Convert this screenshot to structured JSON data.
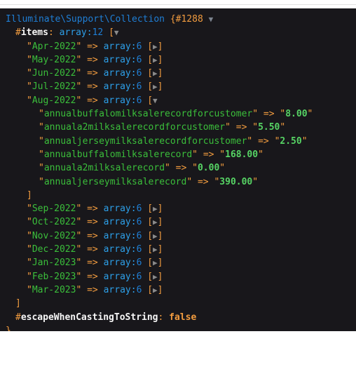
{
  "panel": {
    "background": "#18171B",
    "class_name": "Illuminate\\Support\\Collection",
    "object_id": "{#1288",
    "caret_open": "▼",
    "caret_closed": "▶",
    "open_bracket": "[",
    "close_bracket": "]",
    "close_brace": "}",
    "arrow": "=>",
    "quote": "\"",
    "colon": ":"
  },
  "items_prop": {
    "hash": "#",
    "name": "items",
    "colon": ":",
    "type": "array",
    "type_sep": ":",
    "count": "12"
  },
  "months": [
    {
      "key": "Apr-2022",
      "type": "array",
      "count": "6",
      "expanded": false
    },
    {
      "key": "May-2022",
      "type": "array",
      "count": "6",
      "expanded": false
    },
    {
      "key": "Jun-2022",
      "type": "array",
      "count": "6",
      "expanded": false
    },
    {
      "key": "Jul-2022",
      "type": "array",
      "count": "6",
      "expanded": false
    },
    {
      "key": "Aug-2022",
      "type": "array",
      "count": "6",
      "expanded": true
    },
    {
      "key": "Sep-2022",
      "type": "array",
      "count": "6",
      "expanded": false
    },
    {
      "key": "Oct-2022",
      "type": "array",
      "count": "6",
      "expanded": false
    },
    {
      "key": "Nov-2022",
      "type": "array",
      "count": "6",
      "expanded": false
    },
    {
      "key": "Dec-2022",
      "type": "array",
      "count": "6",
      "expanded": false
    },
    {
      "key": "Jan-2023",
      "type": "array",
      "count": "6",
      "expanded": false
    },
    {
      "key": "Feb-2023",
      "type": "array",
      "count": "6",
      "expanded": false
    },
    {
      "key": "Mar-2023",
      "type": "array",
      "count": "6",
      "expanded": false
    }
  ],
  "expanded_entries": [
    {
      "key": "annualbuffalomilksalerecordforcustomer",
      "value": "8.00"
    },
    {
      "key": "annuala2milksalerecordforcustomer",
      "value": "5.50"
    },
    {
      "key": "annualjerseymilksalerecordforcustomer",
      "value": "2.50"
    },
    {
      "key": "annualbuffalomilksalerecord",
      "value": "168.00"
    },
    {
      "key": "annuala2milksalerecord",
      "value": "0.00"
    },
    {
      "key": "annualjerseymilksalerecord",
      "value": "390.00"
    }
  ],
  "escape_prop": {
    "hash": "#",
    "name": "escapeWhenCastingToString",
    "colon": ":",
    "value": "false"
  },
  "colors": {
    "string": "#3bbf3b",
    "value": "#56d364",
    "punct": "#f29c3f",
    "type": "#2d9fe8",
    "class": "#1f7fd6",
    "background": "#18171B"
  }
}
